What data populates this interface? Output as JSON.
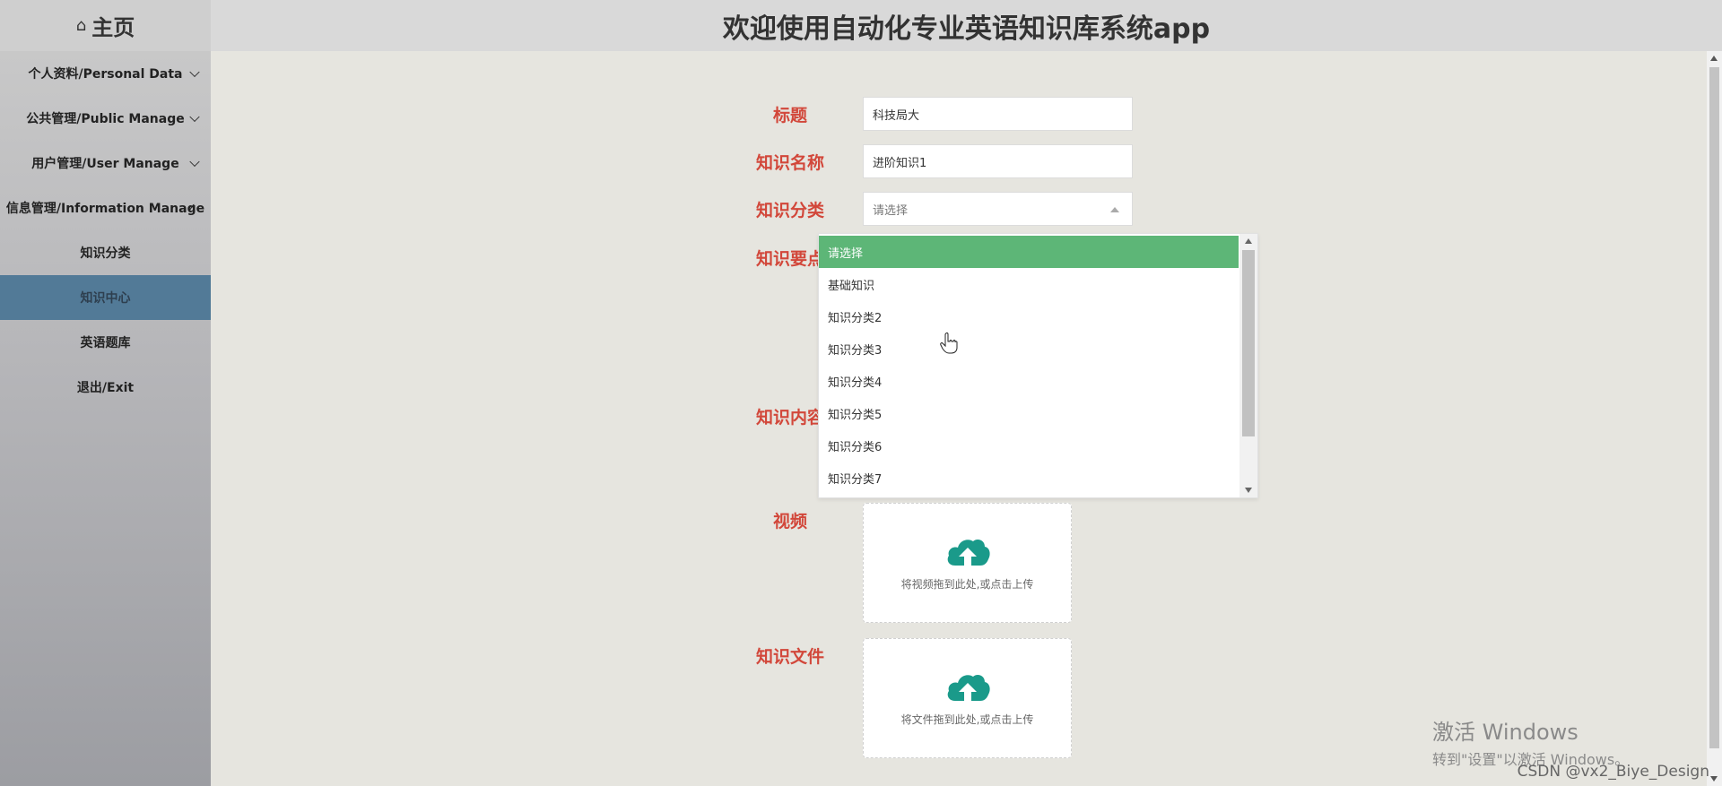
{
  "sidebar": {
    "home_label": "主页",
    "menus": [
      {
        "label": "个人资料/Personal Data"
      },
      {
        "label": "公共管理/Public Manage"
      },
      {
        "label": "用户管理/User Manage"
      },
      {
        "label": "信息管理/Information Manage",
        "mark": "✓"
      }
    ],
    "sub_items": [
      {
        "label": "知识分类"
      },
      {
        "label": "知识中心",
        "active": true
      },
      {
        "label": "英语题库"
      },
      {
        "label": "退出/Exit"
      }
    ]
  },
  "header": {
    "title": "欢迎使用自动化专业英语知识库系统app"
  },
  "form": {
    "title_label": "标题",
    "title_value": "科技局大",
    "name_label": "知识名称",
    "name_value": "进阶知识1",
    "category_label": "知识分类",
    "category_placeholder": "请选择",
    "keypoints_label": "知识要点",
    "content_label": "知识内容",
    "video_label": "视频",
    "video_upload_text": "将视频拖到此处,或点击上传",
    "file_label": "知识文件",
    "file_upload_text": "将文件拖到此处,或点击上传"
  },
  "dropdown": {
    "options": [
      "请选择",
      "基础知识",
      "知识分类2",
      "知识分类3",
      "知识分类4",
      "知识分类5",
      "知识分类6",
      "知识分类7"
    ],
    "selected_index": 0
  },
  "watermark": {
    "line1": "激活 Windows",
    "line2": "转到\"设置\"以激活 Windows。",
    "credit": "CSDN @vx2_Biye_Design"
  },
  "colors": {
    "label_red": "#d2473a",
    "active_menu": "#527a97",
    "selected_option": "#5db677",
    "upload_icon": "#1a9a8a"
  },
  "icons": {
    "home": "home-icon",
    "upload": "cloud-upload-icon",
    "cursor": "hand-pointer-icon"
  }
}
